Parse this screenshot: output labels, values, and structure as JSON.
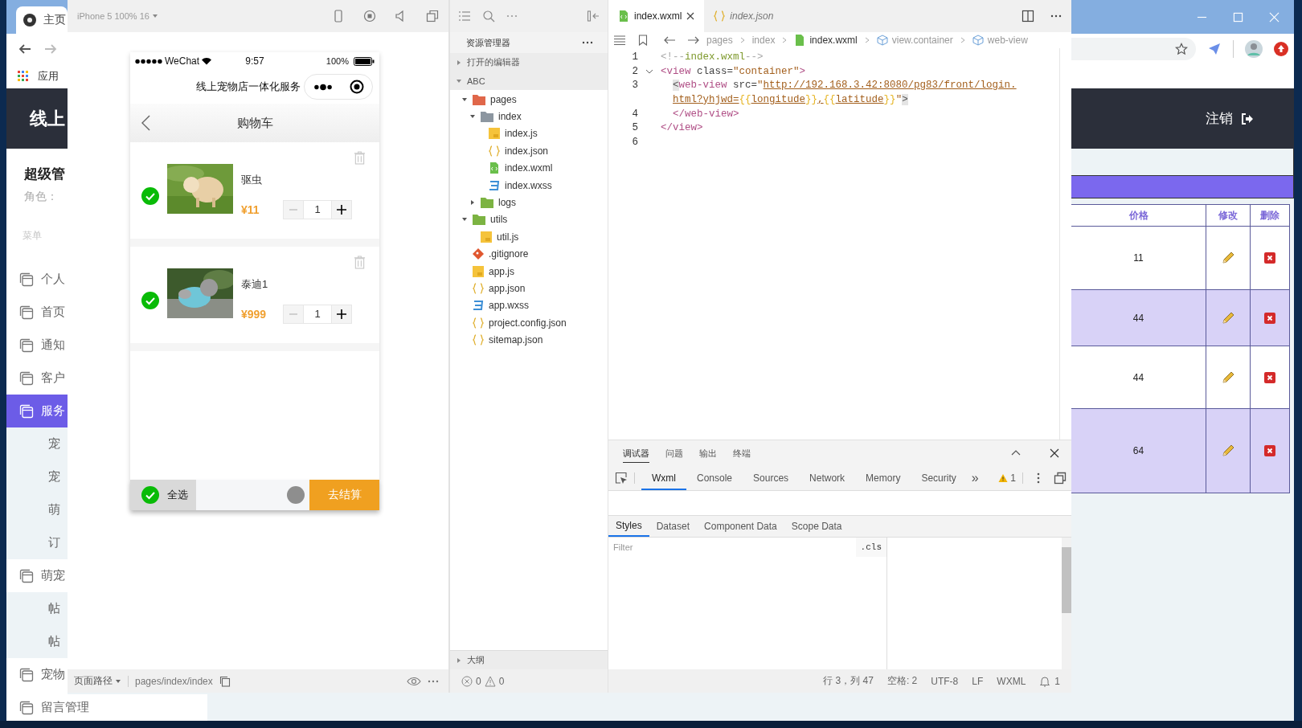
{
  "browser": {
    "tab": {
      "label": "主页"
    },
    "bookmark": "应用",
    "site_title": "线上",
    "user": {
      "name": "超级管",
      "role": "角色："
    },
    "menu_heading": "菜单",
    "menu": [
      {
        "label": "个人",
        "kind": "item",
        "selected": false
      },
      {
        "label": "首页",
        "kind": "item",
        "selected": false
      },
      {
        "label": "通知",
        "kind": "item",
        "selected": false
      },
      {
        "label": "客户",
        "kind": "item",
        "selected": false
      },
      {
        "label": "服务",
        "kind": "item",
        "selected": true
      },
      {
        "label": "宠",
        "kind": "sub",
        "selected": false
      },
      {
        "label": "宠",
        "kind": "sub",
        "selected": false
      },
      {
        "label": "萌",
        "kind": "sub",
        "selected": false
      },
      {
        "label": "订",
        "kind": "sub",
        "selected": false
      },
      {
        "label": "萌宠",
        "kind": "item",
        "selected": false
      },
      {
        "label": "帖",
        "kind": "sub",
        "selected": false
      },
      {
        "label": "帖",
        "kind": "sub",
        "selected": false
      },
      {
        "label": "宠物",
        "kind": "item",
        "selected": false
      },
      {
        "label": "留言管理",
        "kind": "item",
        "selected": false
      }
    ],
    "logout": "注销",
    "table": {
      "columns": [
        "价格",
        "修改",
        "删除"
      ],
      "rows": [
        {
          "price": "11"
        },
        {
          "price": "44"
        },
        {
          "price": "44"
        },
        {
          "price": "64"
        }
      ]
    }
  },
  "devtools": {
    "simulator": {
      "device": "iPhone 5 100% 16",
      "status": {
        "carrier": "WeChat",
        "time": "9:57",
        "battery": "100%"
      },
      "app_title": "线上宠物店一体化服务",
      "page_title": "购物车",
      "cart": [
        {
          "name": "驱虫",
          "price": "¥11",
          "quantity": "1",
          "checked": true
        },
        {
          "name": "泰迪1",
          "price": "¥999",
          "quantity": "1",
          "checked": true
        }
      ],
      "select_all": {
        "label": "全选",
        "checked": true
      },
      "checkout": "去结算",
      "page_path_label": "页面路径",
      "page_path": "pages/index/index"
    },
    "explorer": {
      "title": "资源管理器",
      "open_editors": {
        "label": "打开的编辑器",
        "expanded": false
      },
      "project": {
        "label": "ABC",
        "expanded": true
      },
      "tree": [
        {
          "name": "pages",
          "kind": "folder",
          "color": "#e0674a",
          "expanded": true,
          "children": [
            {
              "name": "index",
              "kind": "folder",
              "color": "#8c96a0",
              "expanded": true,
              "children": [
                {
                  "name": "index.js",
                  "kind": "js"
                },
                {
                  "name": "index.json",
                  "kind": "json"
                },
                {
                  "name": "index.wxml",
                  "kind": "wxml"
                },
                {
                  "name": "index.wxss",
                  "kind": "wxss"
                }
              ]
            },
            {
              "name": "logs",
              "kind": "folder",
              "color": "#7cb342",
              "expanded": false
            }
          ]
        },
        {
          "name": "utils",
          "kind": "folder",
          "color": "#7cb342",
          "expanded": true,
          "children": [
            {
              "name": "util.js",
              "kind": "js"
            }
          ]
        },
        {
          "name": ".gitignore",
          "kind": "git"
        },
        {
          "name": "app.js",
          "kind": "js"
        },
        {
          "name": "app.json",
          "kind": "json"
        },
        {
          "name": "app.wxss",
          "kind": "wxss"
        },
        {
          "name": "project.config.json",
          "kind": "json"
        },
        {
          "name": "sitemap.json",
          "kind": "json"
        }
      ],
      "outline": {
        "label": "大纲",
        "expanded": false
      },
      "problems": {
        "errors": "0",
        "warnings": "0"
      }
    },
    "editor": {
      "tabs": [
        {
          "label": "index.wxml",
          "kind": "wxml",
          "selected": true,
          "preview": false
        },
        {
          "label": "index.json",
          "kind": "json",
          "selected": false,
          "preview": true
        }
      ],
      "breadcrumb": [
        {
          "label": "pages",
          "kind": "folder"
        },
        {
          "label": "index",
          "kind": "folder"
        },
        {
          "label": "index.wxml",
          "kind": "wxml"
        },
        {
          "label": "view.container",
          "kind": "element"
        },
        {
          "label": "web-view",
          "kind": "element"
        }
      ],
      "lines": [
        {
          "number": "1",
          "segments": [
            {
              "text": "<!--",
              "kind": "punct"
            },
            {
              "text": "index.wxml",
              "kind": "comment"
            },
            {
              "text": "-->",
              "kind": "punct"
            }
          ]
        },
        {
          "number": "2",
          "expanded": true,
          "segments": [
            {
              "text": "<view",
              "kind": "tag"
            },
            {
              "text": " class=",
              "kind": "attr"
            },
            {
              "text": "\"container\"",
              "kind": "string"
            },
            {
              "text": ">",
              "kind": "tag"
            }
          ]
        },
        {
          "number": "3",
          "indented": true,
          "segments": [
            {
              "text": "<",
              "kind": "bracket"
            },
            {
              "text": "web-view",
              "kind": "tag"
            },
            {
              "text": " src=",
              "kind": "attr"
            },
            {
              "text": "\"",
              "kind": "string"
            },
            {
              "text": "http://192.168.3.42:8080/pg83/front/login.",
              "kind": "link"
            }
          ]
        },
        {
          "indented": true,
          "segments": [
            {
              "text": "html?yhjwd=",
              "kind": "link"
            },
            {
              "text": "{{",
              "kind": "brace"
            },
            {
              "text": "longitude",
              "kind": "link"
            },
            {
              "text": "}}",
              "kind": "brace"
            },
            {
              "text": ",",
              "kind": "link"
            },
            {
              "text": "{{",
              "kind": "brace"
            },
            {
              "text": "latitude",
              "kind": "link"
            },
            {
              "text": "}}",
              "kind": "brace"
            },
            {
              "text": "\"",
              "kind": "string"
            },
            {
              "text": ">",
              "kind": "bracket"
            }
          ]
        },
        {
          "number": "4",
          "indented": true,
          "segments": [
            {
              "text": "</web-view>",
              "kind": "tag"
            }
          ]
        },
        {
          "number": "5",
          "segments": [
            {
              "text": "</view>",
              "kind": "tag"
            }
          ]
        },
        {
          "number": "6"
        }
      ]
    },
    "debugger": {
      "panel_tabs": [
        {
          "label": "调试器",
          "selected": true
        },
        {
          "label": "问题",
          "selected": false
        },
        {
          "label": "输出",
          "selected": false
        },
        {
          "label": "终端",
          "selected": false
        }
      ],
      "tool_tabs": [
        {
          "label": "Wxml",
          "selected": true
        },
        {
          "label": "Console",
          "selected": false
        },
        {
          "label": "Sources",
          "selected": false
        },
        {
          "label": "Network",
          "selected": false
        },
        {
          "label": "Memory",
          "selected": false
        },
        {
          "label": "Security",
          "selected": false
        }
      ],
      "more": "»",
      "warnings": "1",
      "style_tabs": [
        {
          "label": "Styles",
          "selected": true
        },
        {
          "label": "Dataset",
          "selected": false
        },
        {
          "label": "Component Data",
          "selected": false
        },
        {
          "label": "Scope Data",
          "selected": false
        }
      ],
      "filter_placeholder": "Filter",
      "cls": ".cls"
    },
    "status_bar": {
      "items": [
        "行 3，列 47",
        "空格: 2",
        "UTF-8",
        "LF",
        "WXML"
      ],
      "notifications": "1"
    }
  }
}
